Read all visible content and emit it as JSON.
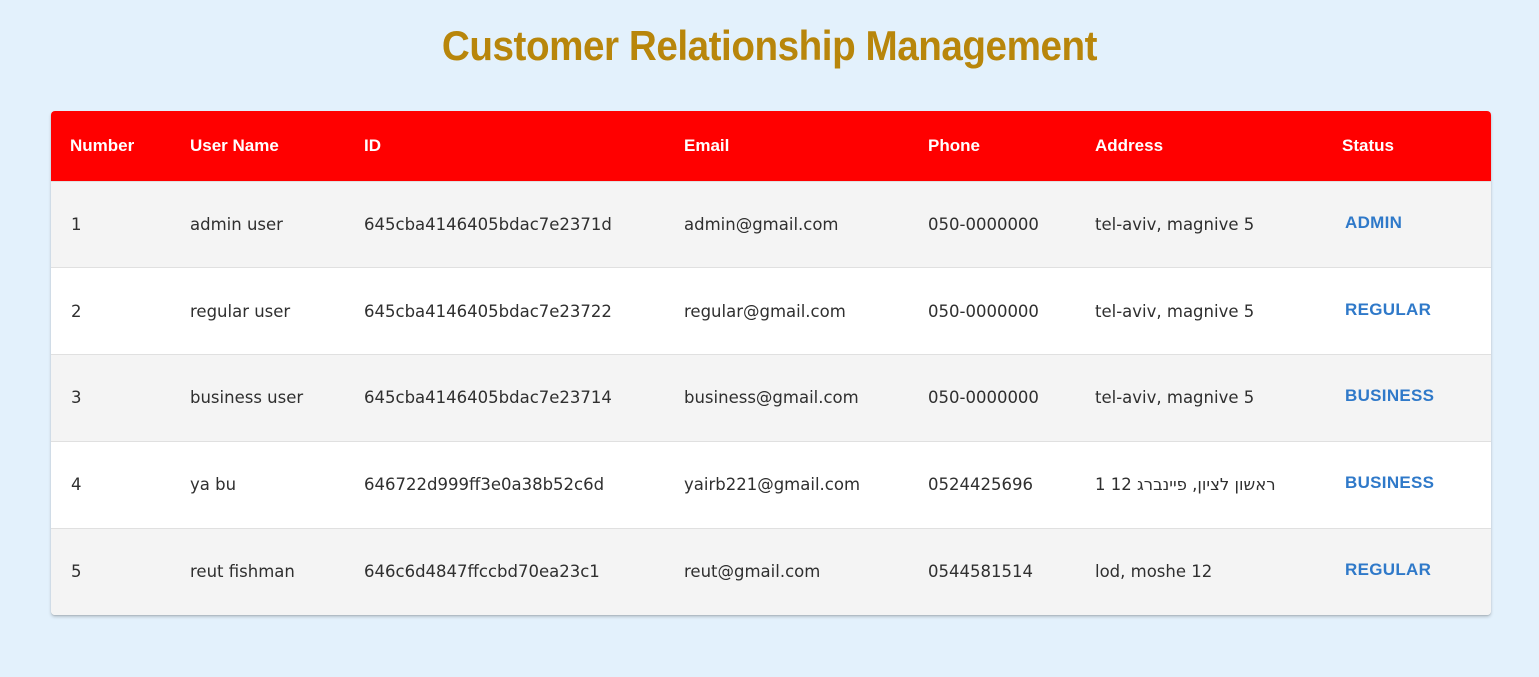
{
  "page": {
    "title": "Customer Relationship Management"
  },
  "table": {
    "headers": {
      "number": "Number",
      "user_name": "User Name",
      "id": "ID",
      "email": "Email",
      "phone": "Phone",
      "address": "Address",
      "status": "Status"
    },
    "rows": [
      {
        "number": "1",
        "user_name": "admin user",
        "id": "645cba4146405bdac7e2371d",
        "email": "admin@gmail.com",
        "phone": "050-0000000",
        "address": "tel-aviv, magnive 5",
        "status": "ADMIN"
      },
      {
        "number": "2",
        "user_name": "regular user",
        "id": "645cba4146405bdac7e23722",
        "email": "regular@gmail.com",
        "phone": "050-0000000",
        "address": "tel-aviv, magnive 5",
        "status": "REGULAR"
      },
      {
        "number": "3",
        "user_name": "business user",
        "id": "645cba4146405bdac7e23714",
        "email": "business@gmail.com",
        "phone": "050-0000000",
        "address": "tel-aviv, magnive 5",
        "status": "BUSINESS"
      },
      {
        "number": "4",
        "user_name": "ya bu",
        "id": "646722d999ff3e0a38b52c6d",
        "email": "yairb221@gmail.com",
        "phone": "0524425696",
        "address": "ראשון לציון, פיינברג 12 1",
        "status": "BUSINESS"
      },
      {
        "number": "5",
        "user_name": "reut fishman",
        "id": "646c6d4847ffccbd70ea23c1",
        "email": "reut@gmail.com",
        "phone": "0544581514",
        "address": "lod, moshe 12",
        "status": "REGULAR"
      }
    ]
  },
  "colors": {
    "background": "#e3f1fc",
    "title": "#b8860b",
    "header_background": "#ff0000",
    "header_text": "#ffffff",
    "status_link": "#2f79c9",
    "row_alt": "#f4f4f4"
  }
}
